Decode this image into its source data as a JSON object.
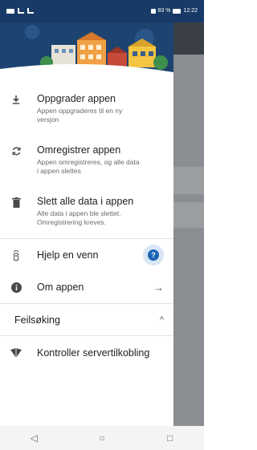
{
  "status_bar": {
    "battery": "83 %",
    "time": "12:22"
  },
  "drawer": {
    "actions": [
      {
        "title": "Oppgrader appen",
        "subtitle": "Appen oppgraderes til en ny versjon",
        "icon": "download-icon"
      },
      {
        "title": "Omregistrer appen",
        "subtitle": "Appen omregistreres, og alle data i appen slettes",
        "icon": "refresh-icon"
      },
      {
        "title": "Slett alle data i appen",
        "subtitle": "Alle data i appen ble slettet. Omregistrering kreves.",
        "icon": "trash-icon"
      }
    ],
    "help": {
      "title": "Hjelp en venn",
      "icon": "remote-icon",
      "badge": "?"
    },
    "about": {
      "title": "Om appen",
      "icon": "info-icon",
      "trailing": "→"
    },
    "troubleshooting": {
      "title": "Feilsøking",
      "trailing": "^"
    },
    "server_check": {
      "title": "Kontroller servertilkobling",
      "icon": "shield-icon"
    }
  },
  "navbar": {
    "back": "◁",
    "home": "○",
    "recent": "□"
  },
  "colors": {
    "header": "#1d4470",
    "status_bar": "#183a66",
    "accent": "#1e64b4"
  }
}
